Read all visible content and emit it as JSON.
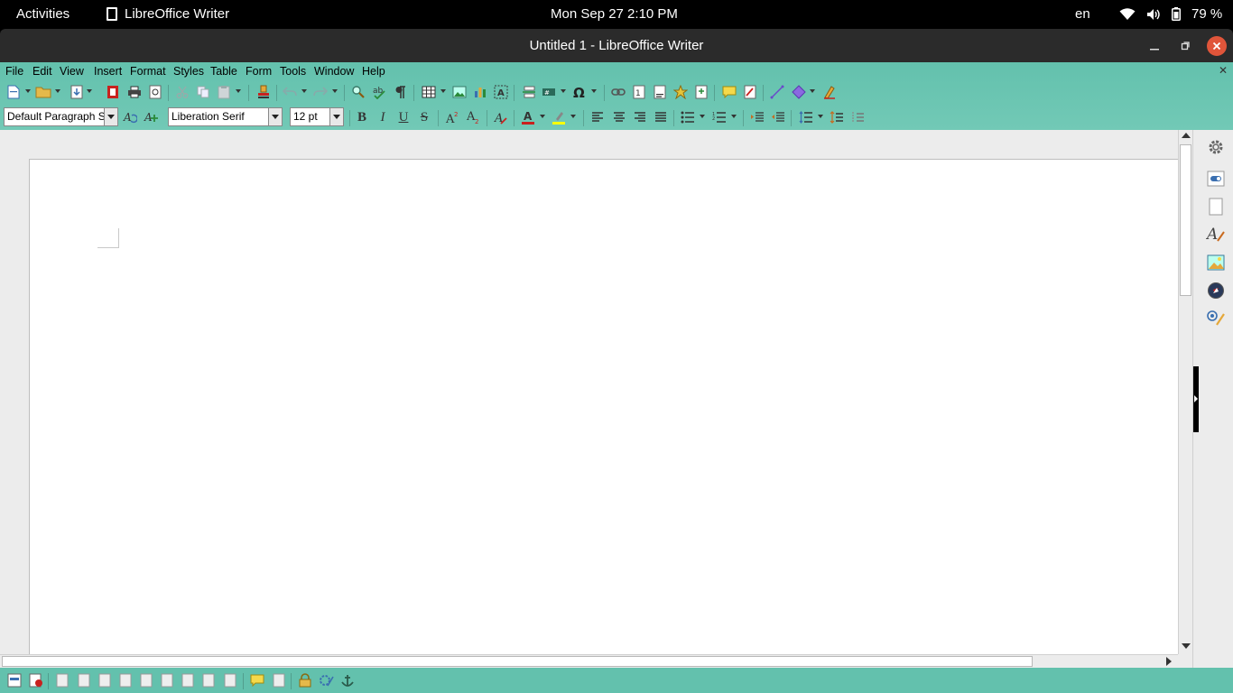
{
  "topbar": {
    "activities": "Activities",
    "app_name": "LibreOffice Writer",
    "clock": "Mon Sep 27  2:10 PM",
    "language": "en",
    "battery": "79 %"
  },
  "window": {
    "title": "Untitled 1 - LibreOffice Writer"
  },
  "menu": [
    "File",
    "Edit",
    "View",
    "Insert",
    "Format",
    "Styles",
    "Table",
    "Form",
    "Tools",
    "Window",
    "Help"
  ],
  "formatting": {
    "paragraph_style": "Default Paragraph Sty",
    "font_name": "Liberation Serif",
    "font_size": "12 pt",
    "bold": "B",
    "italic": "I",
    "underline": "U",
    "strikethrough": "S"
  },
  "colors": {
    "chrome_teal": "#63c1ad",
    "close_button": "#e0553a",
    "font_color": "#c9211e",
    "highlight": "#ffff00"
  }
}
